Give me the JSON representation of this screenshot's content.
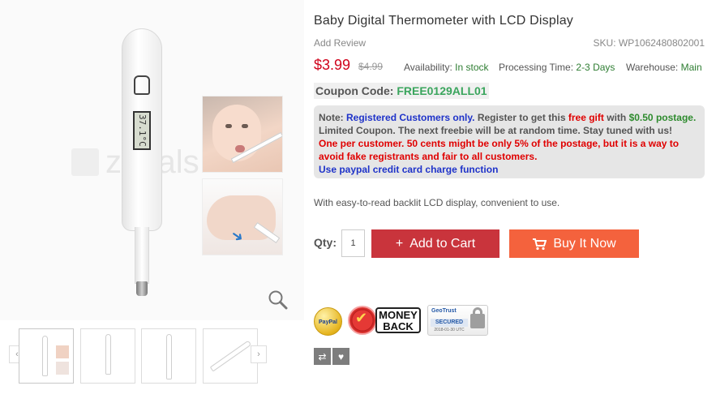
{
  "gallery": {
    "watermark": "zapals",
    "lcd_reading": "37.1°C",
    "thumbnails": [
      "thumbnail-1",
      "thumbnail-2",
      "thumbnail-3",
      "thumbnail-4"
    ],
    "prev_arrow": "‹",
    "next_arrow": "›"
  },
  "product": {
    "title": "Baby Digital Thermometer with LCD Display",
    "add_review": "Add Review",
    "sku_label": "SKU:",
    "sku": "WP1062480802001",
    "price": "$3.99",
    "old_price": "$4.99",
    "availability_label": "Availability:",
    "availability": "In stock",
    "processing_label": "Processing Time:",
    "processing": "2-3 Days",
    "warehouse_label": "Warehouse:",
    "warehouse": "Main"
  },
  "coupon": {
    "label": "Coupon Code:",
    "code": "FREE0129ALL01"
  },
  "note": {
    "prefix": "Note:",
    "registered": "Registered Customers only.",
    "register_text": "Register to get this",
    "free_gift": "free gift",
    "with": "with",
    "postage": "$0.50 postage.",
    "line2": "Limited Coupon. The next freebie will be at random time. Stay tuned with us!",
    "line3": "One per customer. 50 cents might be only 5% of the postage, but it is a way to",
    "line4": "avoid fake registrants and fair to all customers.",
    "line5": "Use paypal credit card charge function"
  },
  "description": "With easy-to-read backlit LCD display, convenient to use.",
  "purchase": {
    "qty_label": "Qty:",
    "qty_value": "1",
    "add_to_cart_icon": "+",
    "add_to_cart": "Add to Cart",
    "buy_now_icon": "cart-icon",
    "buy_now": "Buy It Now"
  },
  "badges": {
    "paypal": "PayPal",
    "money_back": "MONEY BACK",
    "geotrust_name": "GeoTrust",
    "geotrust_secured": "SECURED",
    "geotrust_date": "2018-01-30 UTC"
  },
  "colors": {
    "price": "#d0021b",
    "add_to_cart_bg": "#c9343c",
    "buy_now_bg": "#f4623d",
    "coupon_code": "#3aa55d",
    "stock_green": "#2e7d32"
  }
}
